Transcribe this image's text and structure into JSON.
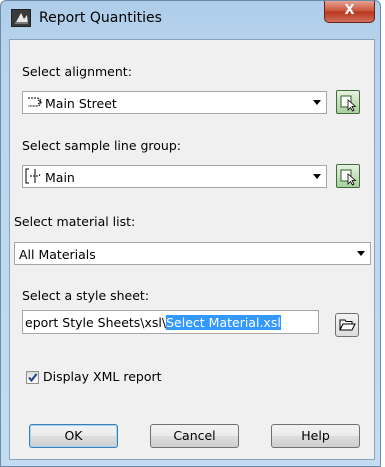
{
  "window": {
    "title": "Report Quantities",
    "close_label": "X"
  },
  "alignment": {
    "label": "Select alignment:",
    "value": "Main Street"
  },
  "sample_line_group": {
    "label": "Select sample line group:",
    "value": "Main"
  },
  "material_list": {
    "label": "Select material list:",
    "value": "All Materials"
  },
  "style_sheet": {
    "label": "Select a style sheet:",
    "path_prefix": "eport Style Sheets\\xsl\\",
    "path_selected": "Select Material.xsl"
  },
  "display_xml": {
    "label": "Display XML report",
    "checked": true
  },
  "buttons": {
    "ok": "OK",
    "cancel": "Cancel",
    "help": "Help"
  },
  "colors": {
    "selection": "#3399ff",
    "client_bg": "#f0f0f0",
    "title_bar": "#b9d5ee"
  },
  "icons": [
    "app-icon",
    "close-icon",
    "alignment-icon",
    "sample-line-icon",
    "pick-icon",
    "folder-icon",
    "check-icon",
    "dropdown-arrow-icon"
  ]
}
